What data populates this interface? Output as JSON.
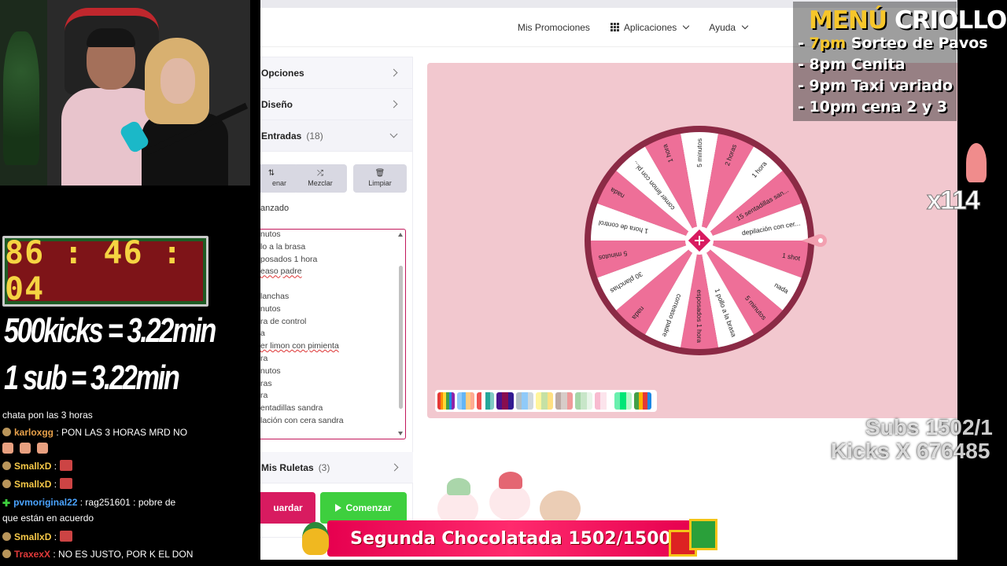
{
  "topnav": {
    "items": [
      {
        "label": "Mis Promociones"
      },
      {
        "label": "Aplicaciones",
        "icon": "grid-icon",
        "dropdown": true
      },
      {
        "label": "Ayuda",
        "dropdown": true
      }
    ]
  },
  "sidebar": {
    "opciones": "Opciones",
    "diseno": "Diseño",
    "entradas": "Entradas",
    "entradas_count": "(18)",
    "tools": [
      {
        "label": "enar",
        "icon": "sort-icon"
      },
      {
        "label": "Mezclar",
        "icon": "shuffle-icon"
      },
      {
        "label": "Limpiar",
        "icon": "trash-icon"
      }
    ],
    "advanced": "anzado",
    "entries": [
      "nutos",
      "lo a la brasa",
      "posados 1 hora",
      "easo padre",
      "",
      "lanchas",
      "nutos",
      "ra de control",
      "a",
      "er limon con pimienta",
      "ra",
      "nutos",
      "ras",
      "ra",
      "entadillas sandra",
      "lación con cera sandra"
    ],
    "mis_ruletas": "Mis Ruletas",
    "mis_ruletas_count": "(3)",
    "save": "uardar",
    "start": "Comenzar"
  },
  "wheel": {
    "segments": [
      "5 minutos",
      "2 horas",
      "1 hora",
      "15 sentadillas san...",
      "depilación con cer...",
      "1 shot",
      "nada",
      "5 minutos",
      "1 pollo a la brasa",
      "esposados 1 hora",
      "correaso padre",
      "nada",
      "30 planchas",
      "5 minutos",
      "1 hora de control",
      "nada",
      "comer limon con pi...",
      "1 hora"
    ],
    "colors": {
      "pink": "#ee6f98",
      "white": "#ffffff",
      "rim": "#8b2a45",
      "center": "#d81b60"
    }
  },
  "palette": [
    [
      "#e53935",
      "#fb8c00",
      "#fdd835",
      "#43a047",
      "#1e88e5",
      "#8e24aa"
    ],
    [
      "#90caf9",
      "#64b5f6",
      "#ffcc80",
      "#ffab91"
    ],
    [
      "#ef5350",
      "#ffffff",
      "#26a69a",
      "#80cbc4"
    ],
    [
      "#4a148c",
      "#880e4f",
      "#311b92"
    ],
    [
      "#b0bec5",
      "#90caf9",
      "#cfd8dc"
    ],
    [
      "#fff59d",
      "#c5e1a5",
      "#ffe082"
    ],
    [
      "#bcaaa4",
      "#d7ccc8",
      "#ef9a9a"
    ],
    [
      "#a5d6a7",
      "#c8e6c9",
      "#e8f5e9"
    ],
    [
      "#f8bbd0",
      "#fce4ec",
      "#ffffff"
    ],
    [
      "#69f0ae",
      "#00e676",
      "#b9f6ca"
    ],
    [
      "#43a047",
      "#ffb300",
      "#e53935",
      "#1e88e5"
    ]
  ],
  "overlay": {
    "timer": "86 : 46 : 04",
    "kicks_rule": "500kicks = 3.22min",
    "sub_rule": "1 sub = 3.22min",
    "menu": {
      "title_a": "MENÚ",
      "title_b": "CRIOLLO",
      "items": [
        {
          "prefix": "- ",
          "time": "7pm",
          "text": " Sorteo de Pavos"
        },
        {
          "prefix": "- ",
          "time": "",
          "text": "8pm Cenita"
        },
        {
          "prefix": "- ",
          "time": "",
          "text": "9pm Taxi variado"
        },
        {
          "prefix": "- ",
          "time": "",
          "text": "10pm cena 2 y 3"
        }
      ]
    },
    "multiplier": "x114",
    "subs": "Subs 1502/1",
    "kicks": "Kicks X 676485",
    "banner": "Segunda Chocolatada 1502/1500"
  },
  "chat": [
    {
      "user": "",
      "text": "chata pon las 3 horas"
    },
    {
      "user": "karloxgg",
      "text": ": PON LAS 3 HORAS MRD NO"
    },
    {
      "user": "",
      "text": ""
    },
    {
      "user": "SmallxD",
      "text": ":"
    },
    {
      "user": "SmallxD",
      "text": ":"
    },
    {
      "user": "pvmoriginal22",
      "text": ": rag251601 : pobre de"
    },
    {
      "user": "",
      "text": "que están en acuerdo"
    },
    {
      "user": "SmallxD",
      "text": ":"
    },
    {
      "user": "TraxexX",
      "text": ": NO ES JUSTO, POR K EL DON"
    }
  ]
}
